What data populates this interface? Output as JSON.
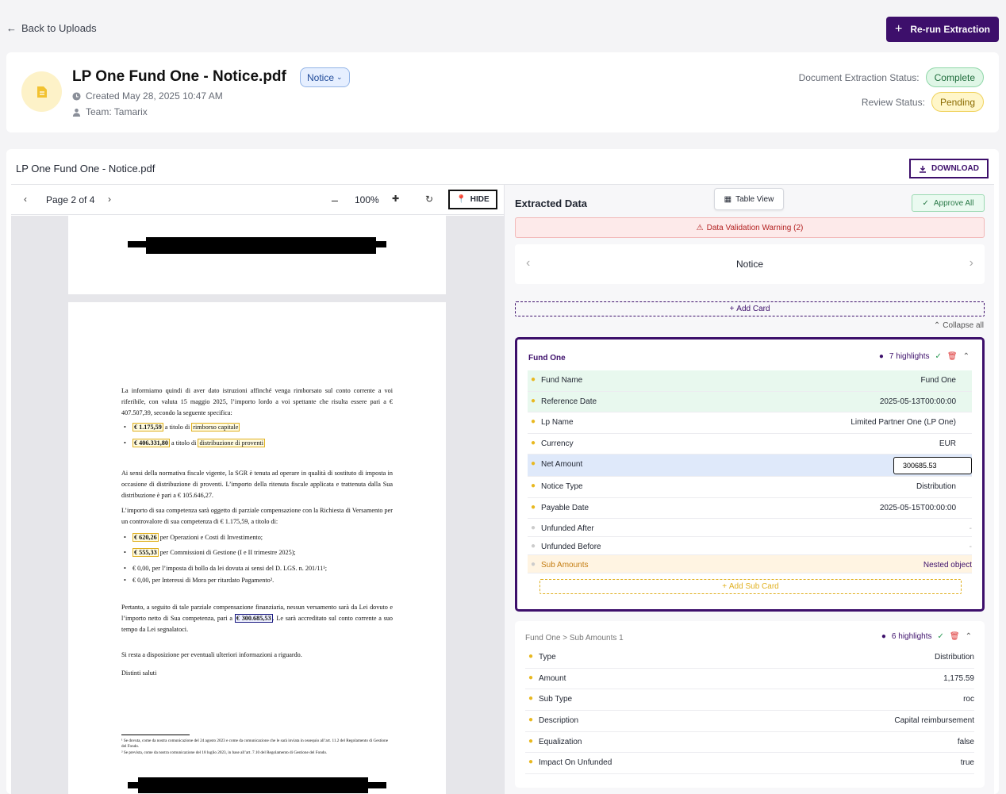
{
  "header": {
    "back_label": "Back to Uploads",
    "rerun_label": "Re-run Extraction",
    "doc_title": "LP One Fund One - Notice.pdf",
    "doc_type_badge": "Notice",
    "created": "Created May 28, 2025 10:47 AM",
    "team": "Team: Tamarix",
    "extraction_status_label": "Document Extraction Status:",
    "extraction_status": "Complete",
    "review_status_label": "Review Status:",
    "review_status": "Pending",
    "colors": {
      "accent": "#3d0f6b",
      "complete": "#dff6e6",
      "pending": "#fff6c9"
    }
  },
  "viewer": {
    "file_title": "LP One Fund One - Notice.pdf",
    "download_label": "DOWNLOAD",
    "toolbar": {
      "page_label": "Page 2 of 4",
      "zoom": "100%",
      "hide_label": "HIDE"
    },
    "pdf": {
      "para1": "La informiamo quindi di aver dato istruzioni affinché venga rimborsato sul conto corrente a voi riferibile, con valuta 15 maggio 2025, l’importo lordo a voi spettante che risulta essere pari a € 407.507,39, secondo la seguente specifica:",
      "bullet1_amount": "€ 1.175,59",
      "bullet1_mid": " a titolo di ",
      "bullet1_label": "rimborso capitale",
      "bullet2_amount": "€ 406.331,80",
      "bullet2_mid": " a titolo di ",
      "bullet2_label": "distribuzione di proventi",
      "para2": "Ai sensi della normativa fiscale vigente, la SGR è tenuta ad operare in qualità di sostituto di imposta in occasione di distribuzione di proventi. L’importo della ritenuta fiscale applicata e trattenuta dalla Sua distribuzione è pari a € 105.646,27.",
      "para3": "L’importo di sua competenza sarà oggetto di parziale compensazione con la Richiesta di Versamento per un controvalore di sua competenza di € 1.175,59, a titolo di:",
      "b3_amount": "€ 620,26",
      "b3_text": " per Operazioni e Costi di Investimento;",
      "b4_amount": "€ 555,33",
      "b4_text": " per Commissioni di Gestione (I e II trimestre 2025);",
      "b5": "€ 0,00, per l’imposta di bollo da lei dovuta ai sensi del D. LGS. n. 201/11¹;",
      "b6": "€ 0,00, per Interessi di Mora per ritardato Pagamento².",
      "para4_a": "Pertanto, a seguito di tale parziale compensazione finanziaria, nessun versamento sarà da Lei dovuto e l’importo netto di Sua competenza, pari a ",
      "para4_amount": "€ 300.685,53",
      "para4_b": ". Le sarà accreditato sul conto corrente a suo tempo da Lei segnalatoci.",
      "para5": "Si resta a disposizione per eventuali ulteriori informazioni a riguardo.",
      "para6": "Distinti saluti",
      "fn1": "¹ Se dovuta, come da nostra comunicazione del 24 agosto 2023 e come da comunicazione che le sarà inviata in ossequio all’art. 11.2 del Regolamento di Gestione del Fondo.",
      "fn2": "² Se prevista, come da nostra comunicazione del 18 luglio 2023, in base all’art. 7.10 del Regolamento di Gestione del Fondo."
    }
  },
  "extracted": {
    "title": "Extracted Data",
    "table_view_label": "Table View",
    "approve_all_label": "Approve All",
    "warning": "Data Validation Warning (2)",
    "carousel_label": "Notice",
    "add_card_label": "Add Card",
    "collapse_all_label": "Collapse all",
    "card1": {
      "title": "Fund One",
      "highlights": "7 highlights",
      "rows": [
        {
          "label": "Fund Name",
          "value": "Fund One"
        },
        {
          "label": "Reference Date",
          "value": "2025-05-13T00:00:00"
        },
        {
          "label": "Lp Name",
          "value": "Limited Partner One (LP One)"
        },
        {
          "label": "Currency",
          "value": "EUR"
        },
        {
          "label": "Net Amount",
          "value": "300685.53"
        },
        {
          "label": "Notice Type",
          "value": "Distribution"
        },
        {
          "label": "Payable Date",
          "value": "2025-05-15T00:00:00"
        },
        {
          "label": "Unfunded After",
          "value": "-"
        },
        {
          "label": "Unfunded Before",
          "value": "-"
        },
        {
          "label": "Sub Amounts",
          "value": "Nested object"
        }
      ],
      "add_sub_card_label": "Add Sub Card"
    },
    "card2": {
      "title": "Fund One > Sub Amounts 1",
      "highlights": "6 highlights",
      "rows": [
        {
          "label": "Type",
          "value": "Distribution"
        },
        {
          "label": "Amount",
          "value": "1,175.59"
        },
        {
          "label": "Sub Type",
          "value": "roc"
        },
        {
          "label": "Description",
          "value": "Capital reimbursement"
        },
        {
          "label": "Equalization",
          "value": "false"
        },
        {
          "label": "Impact On Unfunded",
          "value": "true"
        }
      ]
    }
  }
}
